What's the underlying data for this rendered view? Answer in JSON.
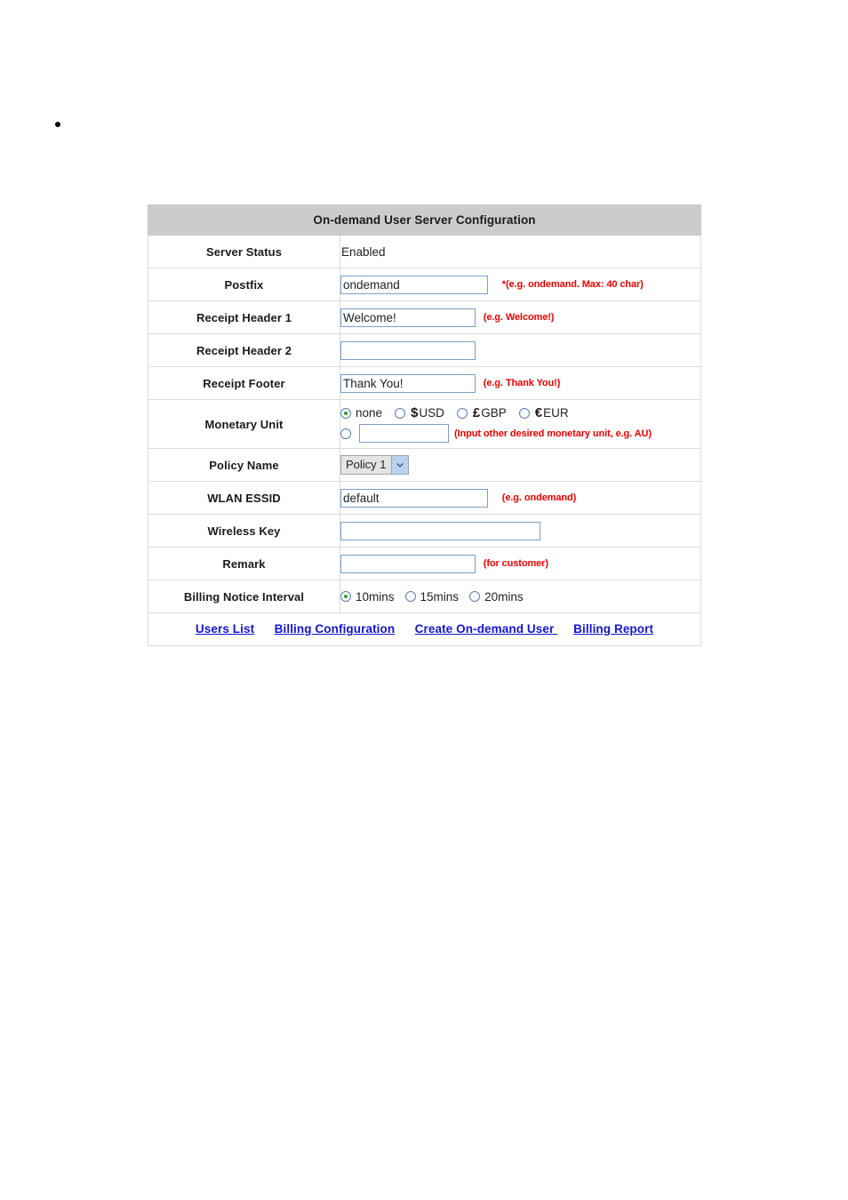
{
  "bullet": {
    "marker": "bullet-dot"
  },
  "table": {
    "title": "On-demand User Server Configuration",
    "rows": {
      "server_status": {
        "label": "Server Status",
        "value": "Enabled"
      },
      "postfix": {
        "label": "Postfix",
        "value": "ondemand",
        "hint": "*(e.g. ondemand. Max: 40 char)"
      },
      "receipt_header_1": {
        "label": "Receipt Header 1",
        "value": "Welcome!",
        "hint": "(e.g. Welcome!)"
      },
      "receipt_header_2": {
        "label": "Receipt Header 2",
        "value": "",
        "hint": ""
      },
      "receipt_footer": {
        "label": "Receipt Footer",
        "value": "Thank You!",
        "hint": "(e.g. Thank You!)"
      },
      "monetary_unit": {
        "label": "Monetary Unit",
        "options": [
          {
            "id": "none",
            "symbol": "",
            "name": "none",
            "selected": true
          },
          {
            "id": "usd",
            "symbol": "$",
            "name": "USD",
            "selected": false
          },
          {
            "id": "gbp",
            "symbol": "£",
            "name": "GBP",
            "selected": false
          },
          {
            "id": "eur",
            "symbol": "€",
            "name": "EUR",
            "selected": false
          }
        ],
        "other_selected": false,
        "other_value": "",
        "other_hint": "(Input other desired monetary unit, e.g. AU)"
      },
      "policy_name": {
        "label": "Policy Name",
        "value": "Policy 1"
      },
      "wlan_essid": {
        "label": "WLAN ESSID",
        "value": "default",
        "hint": "(e.g. ondemand)"
      },
      "wireless_key": {
        "label": "Wireless Key",
        "value": "",
        "hint": ""
      },
      "remark": {
        "label": "Remark",
        "value": "",
        "hint": "(for customer)"
      },
      "billing_notice_interval": {
        "label": "Billing Notice Interval",
        "options": [
          {
            "id": "10mins",
            "name": "10mins",
            "selected": true
          },
          {
            "id": "15mins",
            "name": "15mins",
            "selected": false
          },
          {
            "id": "20mins",
            "name": "20mins",
            "selected": false
          }
        ]
      }
    },
    "links": [
      {
        "label": "Users List"
      },
      {
        "label": "Billing Configuration"
      },
      {
        "label": "Create On-demand User "
      },
      {
        "label": "Billing Report"
      }
    ]
  },
  "colors": {
    "header_bg": "#cccccc",
    "hint_red": "#ee0000",
    "link_blue": "#1414d2",
    "input_border": "#7e9fc6",
    "radio_dot_green": "#2d9d3a",
    "select_arrow_bg": "#b9d2ee"
  }
}
